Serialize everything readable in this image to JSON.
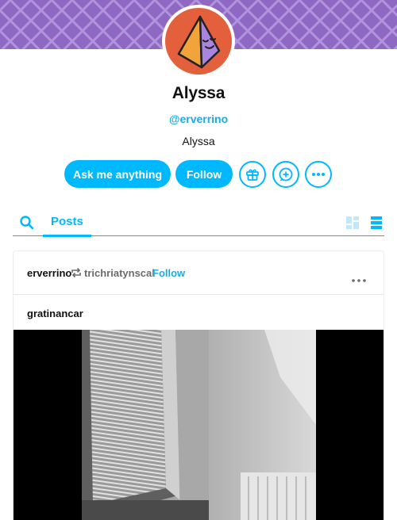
{
  "blog": {
    "title": "Alyssa",
    "handle": "@erverrino",
    "description": "Alyssa"
  },
  "actions": {
    "ask_label": "Ask me anything",
    "follow_label": "Follow",
    "gift_icon": "gift-icon",
    "message_icon": "chat-plus-icon",
    "more_icon": "more-icon"
  },
  "tabs": {
    "search_icon": "search-icon",
    "posts_label": "Posts",
    "grid_view_icon": "grid-view-icon",
    "list_view_icon": "list-view-icon"
  },
  "post": {
    "author": "erverrino",
    "reblog_icon": "reblog-icon",
    "reblogged_from": "trichriatynscal",
    "follow_label": "Follow",
    "more_icon": "more-icon",
    "trail_author": "gratinancar",
    "media": "video"
  },
  "colors": {
    "accent": "#00b8ff",
    "banner": "#8f68c4",
    "avatar_bg": "#e45f3c"
  }
}
